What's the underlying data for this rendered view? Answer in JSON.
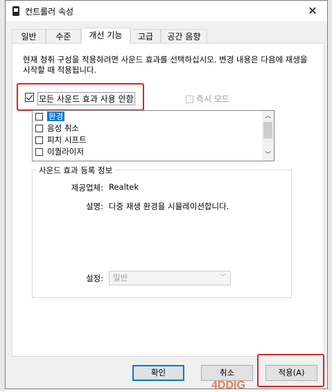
{
  "window": {
    "title": "컨트롤러 속성",
    "close_glyph": "✕"
  },
  "tabs": [
    {
      "label": "일반"
    },
    {
      "label": "수준"
    },
    {
      "label": "개선 기능"
    },
    {
      "label": "고급"
    },
    {
      "label": "공간 음향"
    }
  ],
  "enhancements": {
    "description": "현재 청취 구성을 적용하려면 사운드 효과를 선택하십시오. 변경 내용은 다음에 재생을 시작할 때 적용됩니다.",
    "disable_all_label": "모든 사운드 효과 사용 안함",
    "disable_all_checked": true,
    "immediate_mode_label": "즉시 모드",
    "immediate_mode_enabled": false,
    "effects": [
      {
        "label": "환경",
        "checked": false,
        "selected": true
      },
      {
        "label": "음성 취소",
        "checked": false,
        "selected": false
      },
      {
        "label": "피치 시프트",
        "checked": false,
        "selected": false
      },
      {
        "label": "이퀄라이저",
        "checked": false,
        "selected": false
      }
    ],
    "info_group": {
      "title": "사운드 효과 등록 정보",
      "provider_label": "제공업체:",
      "provider_value": "Realtek",
      "status_label": "설명:",
      "status_value": "다중 재생 환경을 시뮬레이션합니다.",
      "setting_label": "설정:",
      "setting_value": "일반"
    }
  },
  "buttons": {
    "ok": "확인",
    "cancel": "취소",
    "apply": "적용(A)"
  },
  "watermark": "4DDIG",
  "colors": {
    "highlight_box": "#e02020",
    "selection": "#0078d7"
  }
}
